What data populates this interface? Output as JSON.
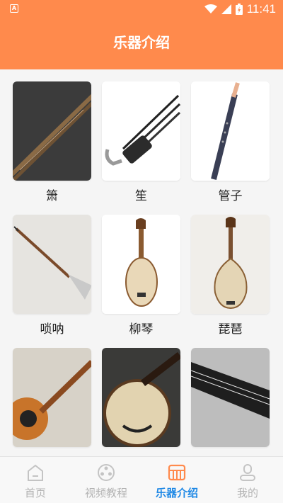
{
  "status_bar": {
    "time": "11:41",
    "app_badge": "A"
  },
  "header": {
    "title": "乐器介绍"
  },
  "instruments": [
    {
      "name": "箫"
    },
    {
      "name": "笙"
    },
    {
      "name": "管子"
    },
    {
      "name": "唢呐"
    },
    {
      "name": "柳琴"
    },
    {
      "name": "琵琶"
    },
    {
      "name": ""
    },
    {
      "name": ""
    },
    {
      "name": ""
    }
  ],
  "bottom_nav": {
    "items": [
      {
        "label": "首页",
        "icon": "home-icon",
        "active": false
      },
      {
        "label": "视频教程",
        "icon": "film-reel-icon",
        "active": false
      },
      {
        "label": "乐器介绍",
        "icon": "instrument-icon",
        "active": true
      },
      {
        "label": "我的",
        "icon": "user-icon",
        "active": false
      }
    ],
    "active_color": "#1e88e5",
    "inactive_color": "#b3b3b3"
  },
  "colors": {
    "accent": "#ff8a4c",
    "background": "#f5f5f5"
  }
}
